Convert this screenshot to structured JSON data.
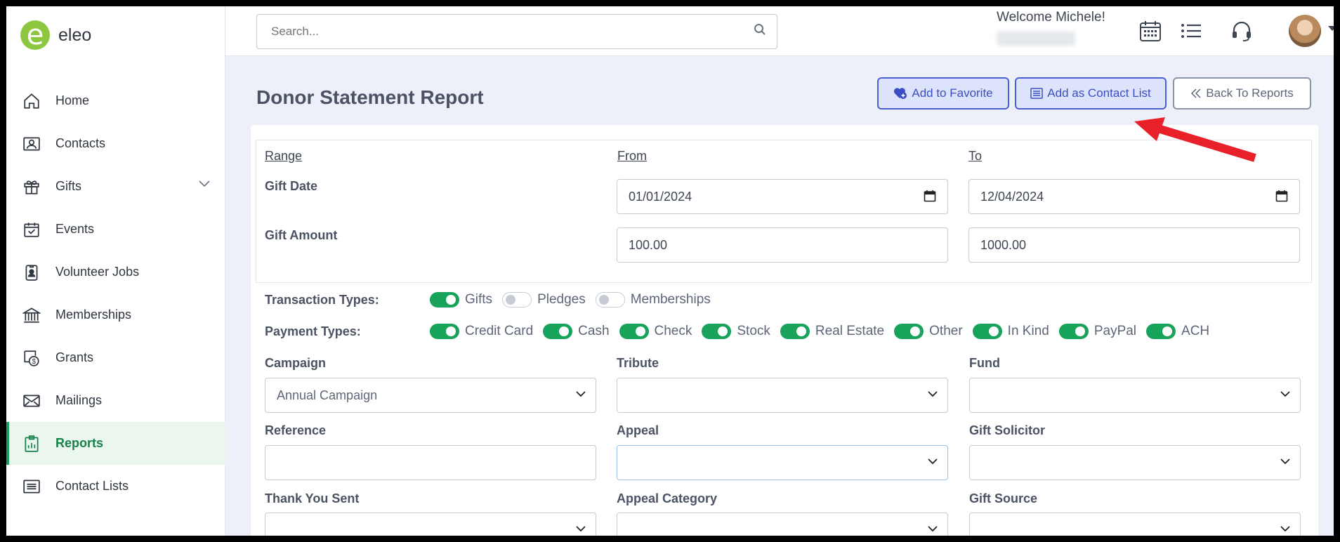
{
  "app": {
    "logo_text": "eleo",
    "logo_letter": "e"
  },
  "sidebar": {
    "items": [
      {
        "label": "Home",
        "icon": "home-icon"
      },
      {
        "label": "Contacts",
        "icon": "contacts-icon"
      },
      {
        "label": "Gifts",
        "icon": "gift-icon"
      },
      {
        "label": "Events",
        "icon": "calendar-check-icon"
      },
      {
        "label": "Volunteer Jobs",
        "icon": "badge-icon"
      },
      {
        "label": "Memberships",
        "icon": "bank-icon"
      },
      {
        "label": "Grants",
        "icon": "money-icon"
      },
      {
        "label": "Mailings",
        "icon": "envelope-icon"
      },
      {
        "label": "Reports",
        "icon": "report-icon",
        "active": true
      },
      {
        "label": "Contact Lists",
        "icon": "list-icon"
      }
    ]
  },
  "topbar": {
    "search_placeholder": "Search...",
    "welcome": "Welcome Michele!"
  },
  "header": {
    "title": "Donor Statement Report",
    "add_favorite": "Add to Favorite",
    "add_contact_list": "Add as Contact List",
    "back": "Back To Reports"
  },
  "range": {
    "col_range": "Range",
    "col_from": "From",
    "col_to": "To",
    "gift_date_label": "Gift Date",
    "gift_date_from": "01/01/2024",
    "gift_date_to": "12/04/2024",
    "gift_amount_label": "Gift Amount",
    "gift_amount_from": "100.00",
    "gift_amount_to": "1000.00"
  },
  "transaction_types": {
    "label": "Transaction Types:",
    "options": [
      {
        "label": "Gifts",
        "on": true
      },
      {
        "label": "Pledges",
        "on": false
      },
      {
        "label": "Memberships",
        "on": false
      }
    ]
  },
  "payment_types": {
    "label": "Payment Types:",
    "options": [
      {
        "label": "Credit Card",
        "on": true
      },
      {
        "label": "Cash",
        "on": true
      },
      {
        "label": "Check",
        "on": true
      },
      {
        "label": "Stock",
        "on": true
      },
      {
        "label": "Real Estate",
        "on": true
      },
      {
        "label": "Other",
        "on": true
      },
      {
        "label": "In Kind",
        "on": true
      },
      {
        "label": "PayPal",
        "on": true
      },
      {
        "label": "ACH",
        "on": true
      }
    ]
  },
  "filters": {
    "campaign_label": "Campaign",
    "campaign_value": "Annual Campaign",
    "tribute_label": "Tribute",
    "fund_label": "Fund",
    "reference_label": "Reference",
    "appeal_label": "Appeal",
    "gift_solicitor_label": "Gift Solicitor",
    "thank_you_label": "Thank You Sent",
    "appeal_category_label": "Appeal Category",
    "gift_source_label": "Gift Source"
  },
  "colors": {
    "accent": "#17a35a",
    "primary": "#4a5fd1",
    "annotation_arrow": "#e8202a"
  }
}
